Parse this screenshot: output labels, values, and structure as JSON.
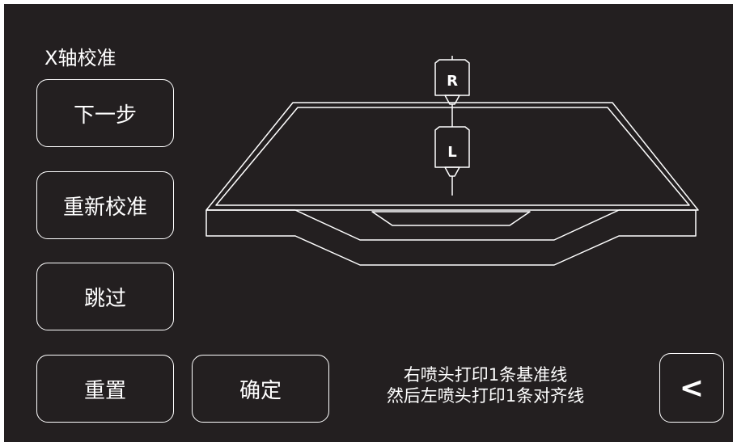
{
  "page": {
    "title": "X轴校准"
  },
  "buttons": {
    "next": "下一步",
    "recalibrate": "重新校准",
    "skip": "跳过",
    "reset": "重置",
    "confirm": "确定",
    "back": "<"
  },
  "instruction": {
    "line1": "右喷头打印1条基准线",
    "line2": "然后左喷头打印1条对齐线"
  },
  "diagram": {
    "nozzle_right_label": "R",
    "nozzle_left_label": "L"
  }
}
